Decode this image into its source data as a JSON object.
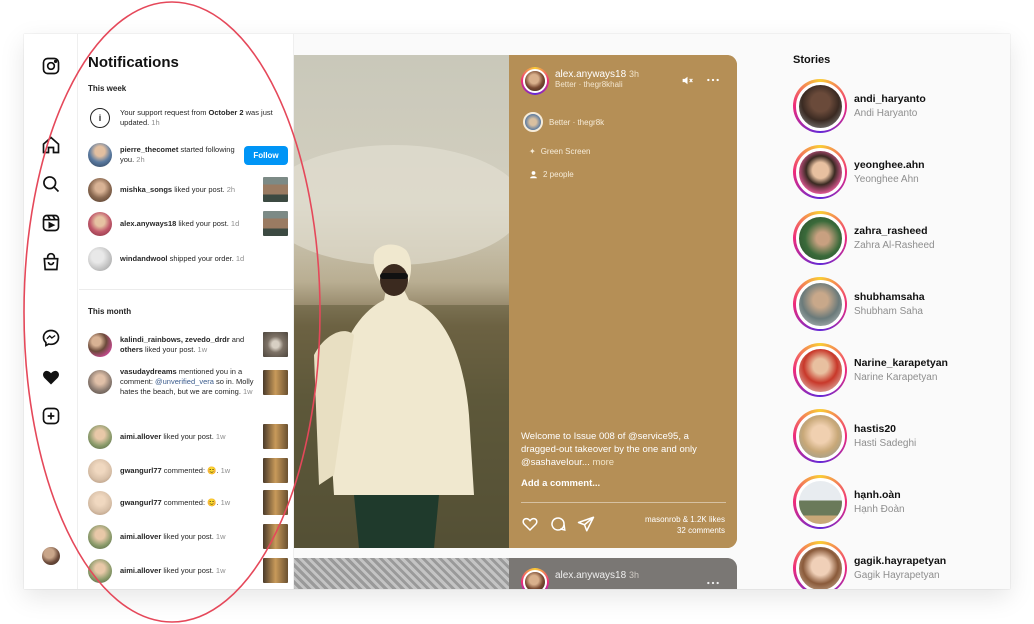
{
  "colors": {
    "accent": "#0095f6",
    "post_bg": "#b58f56",
    "annotation": "#e5485a"
  },
  "rail": {
    "icons": [
      "instagram-icon",
      "home-icon",
      "search-icon",
      "reels-icon",
      "shop-icon",
      "messenger-icon",
      "heart-icon",
      "create-icon",
      "profile-avatar"
    ]
  },
  "notifications": {
    "title": "Notifications",
    "this_week": "This week",
    "this_month": "This month",
    "items": [
      {
        "pre": "Your support request from ",
        "bold": "October 2",
        "post": " was just updated.",
        "time": "1h"
      },
      {
        "user": "pierre_thecomet",
        "text": " started following you.",
        "time": "2h",
        "button": "Follow"
      },
      {
        "user": "mishka_songs",
        "text": " liked your post.",
        "time": "2h"
      },
      {
        "user": "alex.anyways18",
        "text": " liked your post.",
        "time": "1d"
      },
      {
        "user": "windandwool",
        "text": " shipped your order.",
        "time": "1d"
      },
      {
        "user": "kalindi_rainbows, zevedo_drdr",
        "mid": " and ",
        "user2": "others",
        "text": " liked your post.",
        "time": "1w"
      },
      {
        "user": "vasudaydreams",
        "text": " mentioned you in a comment: ",
        "mention": "@unverified_vera",
        "text2": " so in. Molly hates the beach, but we are coming.",
        "time": "1w"
      },
      {
        "user": "aimi.allover",
        "text": " liked your post.",
        "time": "1w"
      },
      {
        "user": "gwangurl77",
        "text": " commented: 😊.",
        "time": "1w"
      },
      {
        "user": "gwangurl77",
        "text": " commented: 😊.",
        "time": "1w"
      },
      {
        "user": "aimi.allover",
        "text": " liked your post.",
        "time": "1w"
      },
      {
        "user": "aimi.allover",
        "text": " liked your post.",
        "time": "1w"
      }
    ]
  },
  "post": {
    "user": "alex.anyways18",
    "time": "3h",
    "audio": "Better · thegr8khali",
    "track": "Better · thegr8k",
    "effect": "Green Screen",
    "people": "2 people",
    "caption": "Welcome to Issue 008 of @service95, a dragged-out takeover by the one and only @sashaveIour...",
    "more": "more",
    "add_comment": "Add a comment...",
    "likes": "masonrob & 1.2K likes",
    "comments": "32 comments"
  },
  "post2": {
    "user": "alex.anyways18",
    "time": "3h"
  },
  "stories": {
    "title": "Stories",
    "items": [
      {
        "user": "andi_haryanto",
        "name": "Andi Haryanto"
      },
      {
        "user": "yeonghee.ahn",
        "name": "Yeonghee Ahn"
      },
      {
        "user": "zahra_rasheed",
        "name": "Zahra Al-Rasheed"
      },
      {
        "user": "shubhamsaha",
        "name": "Shubham Saha"
      },
      {
        "user": "Narine_karapetyan",
        "name": "Narine Karapetyan"
      },
      {
        "user": "hastis20",
        "name": "Hasti Sadeghi"
      },
      {
        "user": "hạnh.oàn",
        "name": "Hạnh Đoàn"
      },
      {
        "user": "gagik.hayrapetyan",
        "name": "Gagik Hayrapetyan"
      }
    ]
  }
}
